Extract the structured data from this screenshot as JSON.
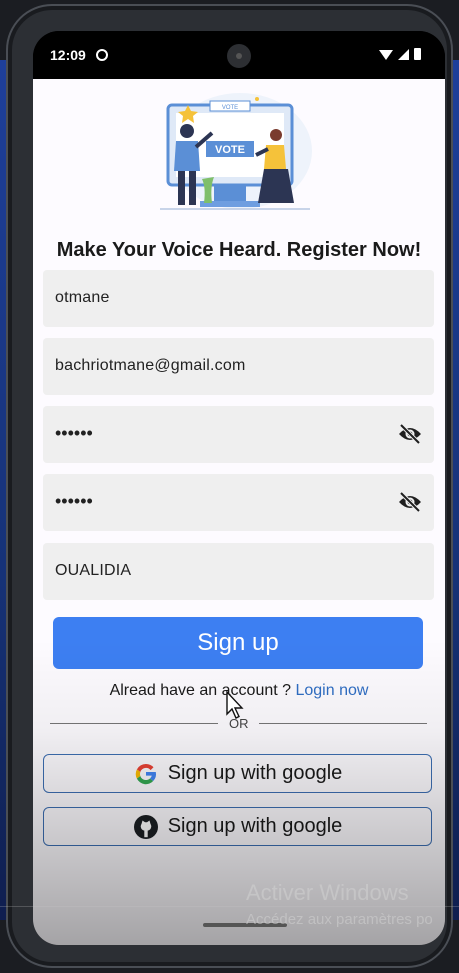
{
  "status_bar": {
    "time": "12:09"
  },
  "app": {
    "illustration_icon": "vote-illustration",
    "vote_sign_top": "VOTE",
    "vote_sign_main": "VOTE",
    "headline": "Make Your Voice Heard. Register Now!",
    "fields": {
      "username": "otmane",
      "email": "bachriotmane@gmail.com",
      "password": "••••••",
      "confirm_password": "••••••",
      "city": "OUALIDIA"
    },
    "signup_label": "Sign up",
    "login_prompt": "Alread have an account ? ",
    "login_link": "Login now",
    "or_label": "OR",
    "google_button": "Sign up with google",
    "github_button": "Sign up with google"
  },
  "watermark": {
    "title": "Activer Windows",
    "subtitle": "Accédez aux paramètres po"
  },
  "colors": {
    "primary": "#3d7ff2",
    "link": "#2f6ec4",
    "field_bg": "#efefef",
    "outline": "#3d6fb3"
  }
}
